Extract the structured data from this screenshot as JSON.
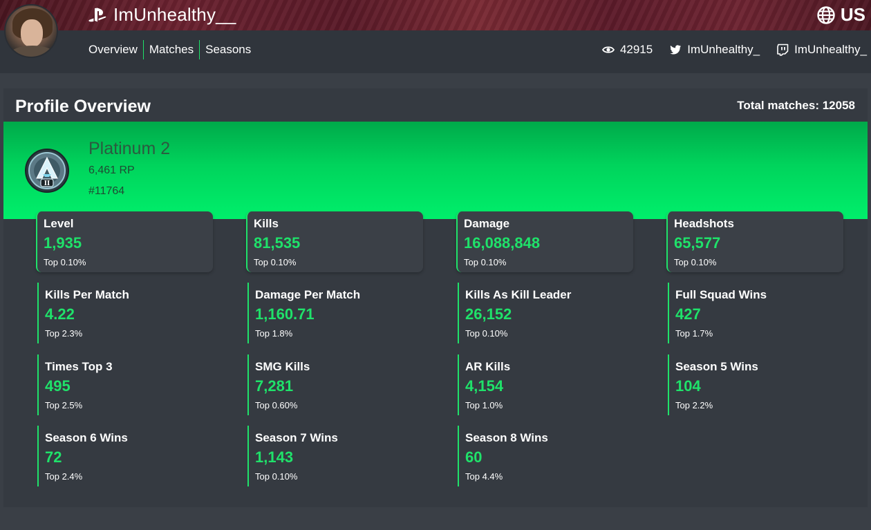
{
  "header": {
    "username": "ImUnhealthy__",
    "region": "US",
    "nav": [
      "Overview",
      "Matches",
      "Seasons"
    ],
    "views": "42915",
    "twitter": "ImUnhealthy_",
    "twitch": "ImUnhealthy_"
  },
  "profile": {
    "title": "Profile Overview",
    "total_matches": "Total matches: 12058",
    "rank": {
      "name": "Platinum 2",
      "rp": "6,461 RP",
      "position": "#11764",
      "badge_text": "II"
    }
  },
  "stats": [
    {
      "label": "Level",
      "value": "1,935",
      "rank": "Top 0.10%"
    },
    {
      "label": "Kills",
      "value": "81,535",
      "rank": "Top 0.10%"
    },
    {
      "label": "Damage",
      "value": "16,088,848",
      "rank": "Top 0.10%"
    },
    {
      "label": "Headshots",
      "value": "65,577",
      "rank": "Top 0.10%"
    },
    {
      "label": "Kills Per Match",
      "value": "4.22",
      "rank": "Top 2.3%"
    },
    {
      "label": "Damage Per Match",
      "value": "1,160.71",
      "rank": "Top 1.8%"
    },
    {
      "label": "Kills As Kill Leader",
      "value": "26,152",
      "rank": "Top 0.10%"
    },
    {
      "label": "Full Squad Wins",
      "value": "427",
      "rank": "Top 1.7%"
    },
    {
      "label": "Times Top 3",
      "value": "495",
      "rank": "Top 2.5%"
    },
    {
      "label": "SMG Kills",
      "value": "7,281",
      "rank": "Top 0.60%"
    },
    {
      "label": "AR Kills",
      "value": "4,154",
      "rank": "Top 1.0%"
    },
    {
      "label": "Season 5 Wins",
      "value": "104",
      "rank": "Top 2.2%"
    },
    {
      "label": "Season 6 Wins",
      "value": "72",
      "rank": "Top 2.4%"
    },
    {
      "label": "Season 7 Wins",
      "value": "1,143",
      "rank": "Top 0.10%"
    },
    {
      "label": "Season 8 Wins",
      "value": "60",
      "rank": "Top 4.4%"
    }
  ],
  "colors": {
    "accent": "#1fe26a",
    "background": "#3a3f46",
    "panel": "#353a41",
    "header_bar": "#30353c"
  },
  "icons": [
    "playstation-icon",
    "globe-icon",
    "eye-icon",
    "twitter-icon",
    "twitch-icon",
    "rank-badge-icon"
  ]
}
